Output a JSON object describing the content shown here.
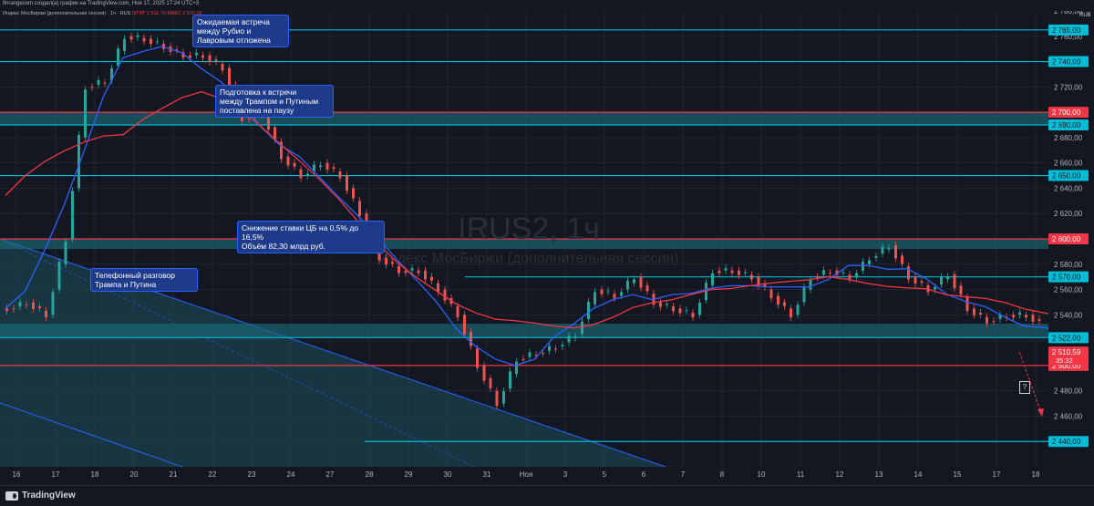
{
  "header": {
    "credit": "finrangecom создал(а) график на TradingView.com, Ноя 17, 2025 17:24 UTC+3",
    "symbol_line": "Индекс МосБиржи (дополнительная сессия) · 1ч · RUS",
    "ohlc": "ОТКР 2 511,76  МАКС 2 515,26",
    "currency": "RUB"
  },
  "watermark": {
    "ticker": "IRUS2, 1ч",
    "name": "Индекс МосБиржи (дополнительная сессия)"
  },
  "annotations": [
    {
      "text": "Ожидаемая встреча\nмежду Рубио и\nЛавровым отложена"
    },
    {
      "text": "Подготовка к встречи\nмежду Трампом и Путиным\nпоставлена на паузу"
    },
    {
      "text": "Снижение ставки ЦБ на 0,5% до 16,5%\nОбъём 82,30 млрд руб."
    },
    {
      "text": "Телефонный разговор\nТрампа и Путина"
    }
  ],
  "info_marker": "?",
  "footer": {
    "logo": "TradingView"
  },
  "colors": {
    "background": "#131722",
    "grid": "#2a2e39",
    "level_cyan": "#00bcd4",
    "level_red": "#f23645",
    "ma_fast": "#2962ff",
    "ma_slow": "#f23645",
    "candle_up": "#26a69a",
    "candle_down": "#ef5350",
    "channel": "#1e4f5c"
  },
  "chart_data": {
    "type": "candlestick",
    "ylim": [
      2420,
      2780
    ],
    "y_ticks": [
      "2 440,00",
      "2 460,00",
      "2 480,00",
      "2 500,00",
      "2 520,00",
      "2 540,00",
      "2 560,00",
      "2 580,00",
      "2 600,00",
      "2 620,00",
      "2 640,00",
      "2 660,00",
      "2 680,00",
      "2 700,00",
      "2 720,00",
      "2 740,00",
      "2 760,00",
      "2 780,00"
    ],
    "x_labels": [
      "16",
      "17",
      "18",
      "20",
      "21",
      "22",
      "23",
      "24",
      "27",
      "28",
      "29",
      "30",
      "31",
      "Ноя",
      "3",
      "5",
      "6",
      "7",
      "8",
      "10",
      "11",
      "12",
      "13",
      "14",
      "15",
      "17",
      "18"
    ],
    "levels": [
      {
        "value": 2765,
        "label": "2 765,00",
        "color": "cyan"
      },
      {
        "value": 2740,
        "label": "2 740,00",
        "color": "cyan"
      },
      {
        "value": 2700,
        "label": "2 700,00",
        "color": "red"
      },
      {
        "value": 2690,
        "label": "2 690,00",
        "color": "cyan"
      },
      {
        "value": 2650,
        "label": "2 650,00",
        "color": "cyan"
      },
      {
        "value": 2600,
        "label": "2 600,00",
        "color": "red"
      },
      {
        "value": 2570,
        "label": "2 570,00",
        "color": "cyan"
      },
      {
        "value": 2522,
        "label": "2 522,00",
        "color": "cyan"
      },
      {
        "value": 2500,
        "label": "2 500,00",
        "color": "red"
      },
      {
        "value": 2440,
        "label": "2 440,00",
        "color": "cyan"
      }
    ],
    "last_price": {
      "value": 2510.59,
      "label": "2 510,59",
      "countdown": "35:32"
    },
    "zones": [
      {
        "from": 2690,
        "to": 2700
      },
      {
        "from": 2592,
        "to": 2600
      },
      {
        "from": 2522,
        "to": 2533
      }
    ],
    "series": [
      {
        "name": "close",
        "x": [
          0,
          0.5,
          1,
          1.5,
          2,
          2.5,
          3,
          3.5,
          4,
          4.5,
          5,
          5.5,
          6,
          6.5,
          7,
          7.5,
          8,
          8.5,
          9,
          9.5,
          10,
          10.5,
          11,
          11.5,
          12,
          12.5,
          13,
          13.5,
          14,
          14.5,
          15,
          15.5,
          16,
          16.5,
          17,
          17.5,
          18,
          18.5,
          19,
          19.5,
          20,
          20.5,
          21,
          21.5,
          22,
          22.5,
          23,
          23.5,
          24,
          24.5,
          25,
          25.5,
          26,
          26.5,
          27
        ],
        "values": [
          2545,
          2550,
          2540,
          2600,
          2720,
          2725,
          2760,
          2758,
          2752,
          2745,
          2745,
          2735,
          2695,
          2700,
          2665,
          2650,
          2660,
          2650,
          2620,
          2585,
          2575,
          2575,
          2560,
          2540,
          2500,
          2470,
          2505,
          2510,
          2515,
          2525,
          2560,
          2555,
          2570,
          2550,
          2545,
          2540,
          2575,
          2575,
          2570,
          2555,
          2540,
          2570,
          2575,
          2570,
          2585,
          2595,
          2570,
          2560,
          2572,
          2545,
          2535,
          2540,
          2540,
          2530,
          2510
        ]
      }
    ]
  }
}
